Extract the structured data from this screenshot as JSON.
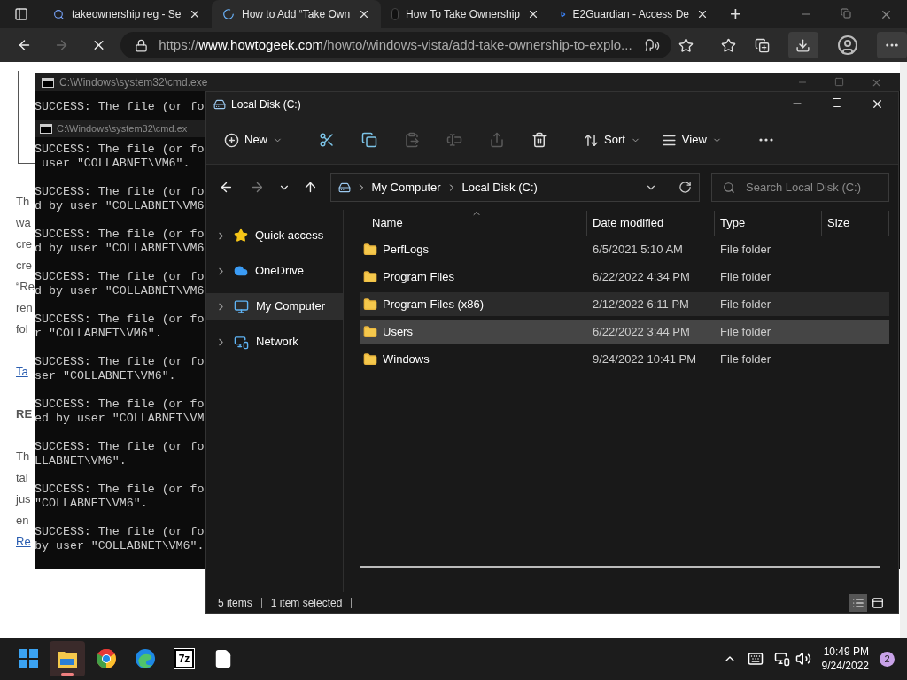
{
  "browser": {
    "tabs": [
      {
        "title": "takeownership reg - Se",
        "selected": false
      },
      {
        "title": "How to Add “Take Own",
        "selected": true
      },
      {
        "title": "How To Take Ownership",
        "selected": false
      },
      {
        "title": "E2Guardian - Access De",
        "selected": false
      }
    ],
    "new_tab": "+",
    "forward_disabled": true,
    "url": {
      "scheme": "https://",
      "domain": "www.howtogeek.com",
      "path": "/howto/windows-vista/add-take-ownership-to-explo..."
    },
    "page": {
      "paragraphs": [
        {
          "lines": [
            {
              "text": "Th",
              "kind": "text"
            },
            {
              "text": "wa",
              "kind": "text"
            },
            {
              "text": "cre",
              "kind": "text"
            },
            {
              "text": "cre",
              "kind": "text"
            },
            {
              "text": "“Re",
              "kind": "text"
            },
            {
              "text": "ren",
              "kind": "text"
            },
            {
              "text": "fol",
              "kind": "text"
            }
          ]
        },
        {
          "lines": [
            {
              "text": "Ta",
              "kind": "link"
            }
          ]
        },
        {
          "lines": [
            {
              "text": "RE",
              "kind": "heading"
            }
          ]
        },
        {
          "lines": [
            {
              "text": "Th",
              "kind": "text"
            },
            {
              "text": "tal",
              "kind": "text"
            },
            {
              "text": "jus",
              "kind": "text"
            },
            {
              "text": "en",
              "kind": "text"
            },
            {
              "text": "Re",
              "kind": "link"
            }
          ]
        }
      ]
    }
  },
  "cmd_back": {
    "title": "C:\\Windows\\system32\\cmd.exe",
    "lines": [
      "SUCCESS: The file (or fo"
    ]
  },
  "cmd_front": {
    "title": "C:\\Windows\\system32\\cmd.ex",
    "blocks": [
      {
        "first": "SUCCESS: The file (or fo",
        "second": " user \"COLLABNET\\VM6\"."
      },
      {
        "first": "SUCCESS: The file (or fo",
        "second": "d by user \"COLLABNET\\VM6"
      },
      {
        "first": "SUCCESS: The file (or fo",
        "second": "d by user \"COLLABNET\\VM6"
      },
      {
        "first": "SUCCESS: The file (or fo",
        "second": "d by user \"COLLABNET\\VM6"
      },
      {
        "first": "SUCCESS: The file (or fo",
        "second": "r \"COLLABNET\\VM6\"."
      },
      {
        "first": "SUCCESS: The file (or fo",
        "second": "ser \"COLLABNET\\VM6\"."
      },
      {
        "first": "SUCCESS: The file (or fo",
        "second": "ed by user \"COLLABNET\\VM"
      },
      {
        "first": "SUCCESS: The file (or fo",
        "second": "LLABNET\\VM6\"."
      },
      {
        "first": "SUCCESS: The file (or fo",
        "second": "\"COLLABNET\\VM6\"."
      },
      {
        "first": "SUCCESS: The file (or fo",
        "second": "by user \"COLLABNET\\VM6\"."
      }
    ]
  },
  "explorer": {
    "title": "Local Disk (C:)",
    "toolbar": [
      {
        "kind": "menu",
        "label": "New",
        "disabled": false
      },
      {
        "kind": "icon",
        "disabled": false
      },
      {
        "kind": "icon",
        "disabled": false
      },
      {
        "kind": "icon",
        "disabled": true
      },
      {
        "kind": "icon",
        "disabled": true
      },
      {
        "kind": "icon",
        "disabled": true
      },
      {
        "kind": "icon",
        "disabled": false
      },
      {
        "kind": "menu",
        "label": "Sort",
        "disabled": false
      },
      {
        "kind": "menu",
        "label": "View",
        "disabled": false
      },
      {
        "kind": "icon",
        "disabled": false
      }
    ],
    "forward_disabled": true,
    "breadcrumb": [
      "My Computer",
      "Local Disk (C:)"
    ],
    "search": {
      "placeholder": "Search Local Disk (C:)"
    },
    "sidebar": [
      {
        "label": "Quick access",
        "selected": false
      },
      {
        "label": "OneDrive",
        "selected": false
      },
      {
        "label": "My Computer",
        "selected": true
      },
      {
        "label": "Network",
        "selected": false
      }
    ],
    "columns": [
      "Name",
      "Date modified",
      "Type",
      "Size"
    ],
    "rows": [
      {
        "name": "PerfLogs",
        "date": "6/5/2021 5:10 AM",
        "type": "File folder",
        "selected": false,
        "hovered": false
      },
      {
        "name": "Program Files",
        "date": "6/22/2022 4:34 PM",
        "type": "File folder",
        "selected": false,
        "hovered": false
      },
      {
        "name": "Program Files (x86)",
        "date": "2/12/2022 6:11 PM",
        "type": "File folder",
        "selected": false,
        "hovered": true
      },
      {
        "name": "Users",
        "date": "6/22/2022 3:44 PM",
        "type": "File folder",
        "selected": true,
        "hovered": false
      },
      {
        "name": "Windows",
        "date": "9/24/2022 10:41 PM",
        "type": "File folder",
        "selected": false,
        "hovered": false
      }
    ],
    "status": [
      "5 items",
      "1 item selected"
    ],
    "views": [
      {
        "selected": true
      },
      {
        "selected": false
      }
    ]
  },
  "taskbar": {
    "apps": [
      {
        "selected": false
      },
      {
        "selected": true
      },
      {
        "selected": false
      },
      {
        "selected": false
      },
      {
        "selected": false
      },
      {
        "selected": false
      }
    ],
    "app_7z": "7z",
    "time": "10:49 PM",
    "date": "9/24/2022",
    "notifications": "2"
  }
}
